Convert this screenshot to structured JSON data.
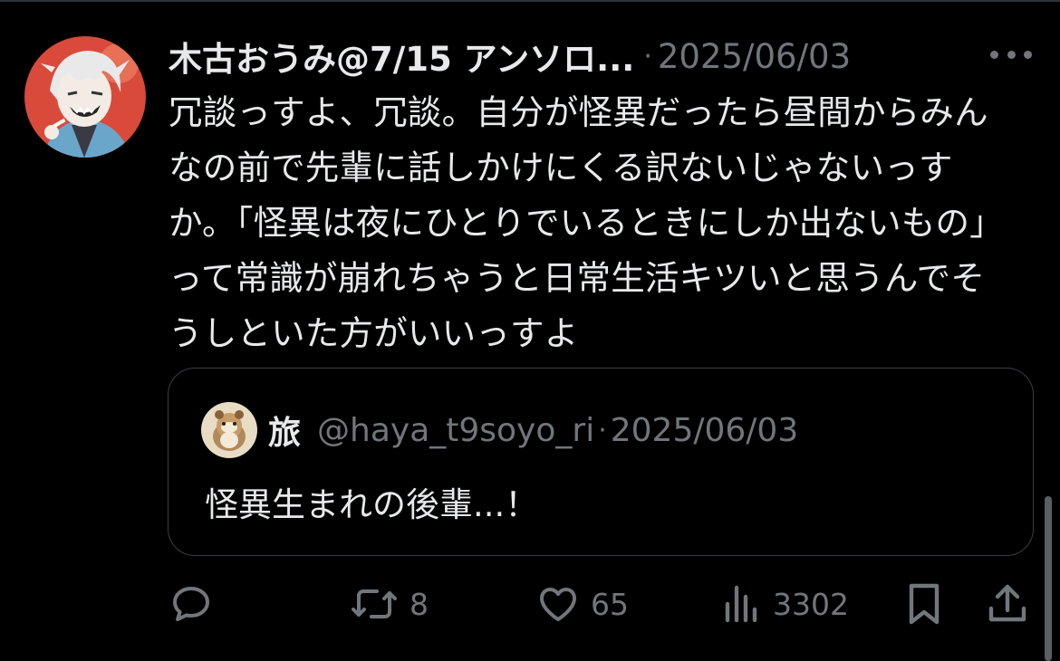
{
  "tweet": {
    "display_name": "木古おうみ@7/15 アンソロ...",
    "separator": "·",
    "timestamp": "2025/06/03",
    "text": "冗談っすよ、冗談。自分が怪異だったら昼間からみんなの前で先輩に話しかけにくる訳ないじゃないっすか。「怪異は夜にひとりでいるときにしか出ないもの」って常識が崩れちゃうと日常生活キツいと思うんでそうしといた方がいいっすよ"
  },
  "quote": {
    "name": "旅",
    "handle": "@haya_t9soyo_ri",
    "separator": "·",
    "timestamp": "2025/06/03",
    "text": "怪異生まれの後輩...！"
  },
  "actions": {
    "reply_icon": "speech-bubble-icon",
    "retweet_icon": "retweet-arrows-icon",
    "retweet_count": "8",
    "like_icon": "heart-icon",
    "like_count": "65",
    "views_icon": "bar-chart-icon",
    "views_count": "3302",
    "bookmark_icon": "bookmark-icon",
    "share_icon": "share-upload-icon"
  },
  "colors": {
    "background": "#000000",
    "text_primary": "#e7e9ea",
    "text_secondary": "#71767b",
    "border": "#3a3e42"
  }
}
